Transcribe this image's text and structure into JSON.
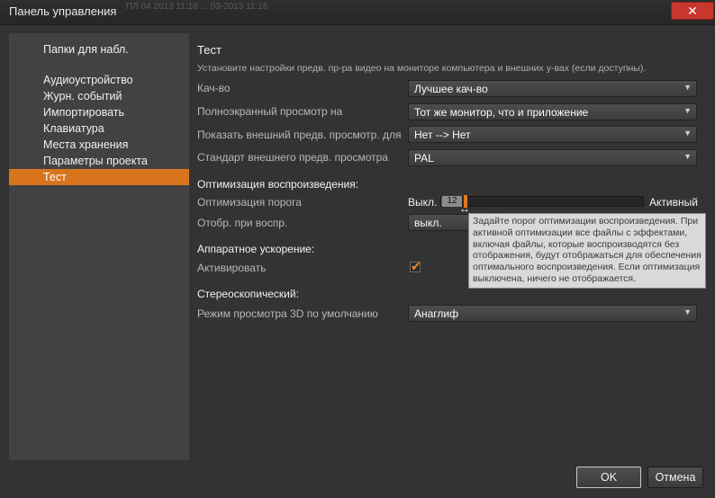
{
  "window": {
    "title": "Панель управления",
    "ghost_text": "ПЛ 04 2013 11:16 ... 03-2013 11:16",
    "close_glyph": "✕"
  },
  "sidebar": {
    "items": [
      {
        "label": "Папки для набл."
      },
      {
        "label": "Аудиоустройство"
      },
      {
        "label": "Журн. событий"
      },
      {
        "label": "Импортировать"
      },
      {
        "label": "Клавиатура"
      },
      {
        "label": "Места хранения"
      },
      {
        "label": "Параметры проекта"
      },
      {
        "label": "Тест",
        "selected": true
      }
    ]
  },
  "main": {
    "heading": "Тест",
    "description": "Установите настройки предв. пр-ра видео на мониторе компьютера и внешних у-вах (если доступны).",
    "quality": {
      "label": "Кач-во",
      "value": "Лучшее кач-во"
    },
    "fullscreen": {
      "label": "Полноэкранный просмотр на",
      "value": "Тот же монитор, что и приложение"
    },
    "external_preview": {
      "label": "Показать внешний предв. просмотр. для",
      "value": "Нет --> Нет"
    },
    "external_standard": {
      "label": "Стандарт внешнего предв. просмотра",
      "value": "PAL"
    },
    "playback_section": "Оптимизация воспроизведения:",
    "threshold": {
      "label": "Оптимизация порога",
      "min_label": "Выкл.",
      "max_label": "Активный",
      "value": "12",
      "fraction": 0.05
    },
    "display_playback": {
      "label": "Отобр. при воспр.",
      "value": "выкл."
    },
    "tooltip": "Задайте порог оптимизации воспроизведения. При активной оптимизации все файлы с эффектами, включая файлы, которые воспроизводятся без отображения, будут отображаться для обеспечения оптимального воспроизведения. Если оптимизация выключена, ничего не отображается.",
    "hw_section": "Аппаратное ускорение:",
    "hw_activate": {
      "label": "Активировать",
      "checked": true,
      "check_glyph": "✔"
    },
    "stereo_section": "Стереоскопический:",
    "stereo_mode": {
      "label": "Режим просмотра 3D по умолчанию",
      "value": "Анаглиф"
    }
  },
  "buttons": {
    "ok": "OK",
    "cancel": "Отмена"
  },
  "icons": {
    "dropdown": "▼",
    "resize_cursor": "↔"
  },
  "colors": {
    "accent": "#d8751c",
    "close": "#c7372d"
  }
}
